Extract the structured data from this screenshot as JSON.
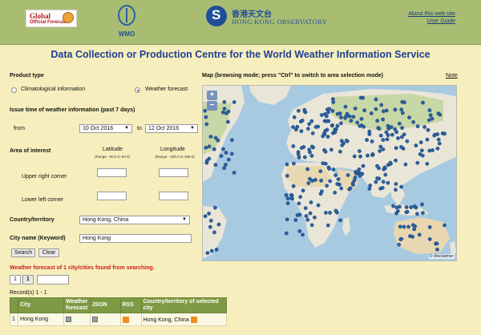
{
  "header": {
    "global_line1": "Global",
    "global_line2": "Official Forecasts",
    "wmo_label": "WMO",
    "hko_cn": "香港天文台",
    "hko_en": "HONG KONG OBSERVATORY",
    "links": [
      "About this web site",
      "User Guide"
    ]
  },
  "page_title": "Data Collection or Production Centre for the World Weather Information Service",
  "form": {
    "product_type_label": "Product type",
    "product_options": [
      {
        "label": "Climatological information",
        "selected": false
      },
      {
        "label": "Weather forecast",
        "selected": true
      }
    ],
    "issue_time_label": "Issue time of weather information (past 7 days)",
    "from_label": "from",
    "from_value": "10 Oct 2016",
    "to_label": "to",
    "to_value": "12 Oct 2016",
    "area_label": "Area of interest",
    "latitude_label": "Latitude",
    "latitude_range": "(Range: -90.0 to 90.0)",
    "longitude_label": "Longitude",
    "longitude_range": "(Range: -180.0 to 180.0)",
    "upper_right_label": "Upper right corner",
    "lower_left_label": "Lower left corner",
    "country_label": "Country/territory",
    "country_value": "Hong Kong, China",
    "city_label": "City name (Keyword)",
    "city_value": "Hong Kong",
    "search_label": "Search",
    "clear_label": "Clear"
  },
  "map": {
    "label": "Map (browsing mode; press \"Ctrl\" to switch to area selection mode)",
    "note_label": "Note",
    "zoom_in": "+",
    "zoom_out": "−",
    "disclaimer": "© disclaimer",
    "colors": {
      "ocean": "#a8cae1",
      "land": "#e9e6d8",
      "forest": "#c8d7a6",
      "desert": "#e8d7b0",
      "marker": "#2c5fa0"
    }
  },
  "results": {
    "found_text": "Weather forecast of 1 city/cities found from searching.",
    "pager_total": "1",
    "pager_current": "1",
    "records_text": "Record(s) 1 - 1",
    "columns": [
      "City",
      "Weather forecast",
      "JSON",
      "RSS",
      "Country/territory of selected city"
    ],
    "rows": [
      {
        "index": "1",
        "city": "Hong Kong",
        "country": "Hong Kong, China"
      }
    ]
  }
}
